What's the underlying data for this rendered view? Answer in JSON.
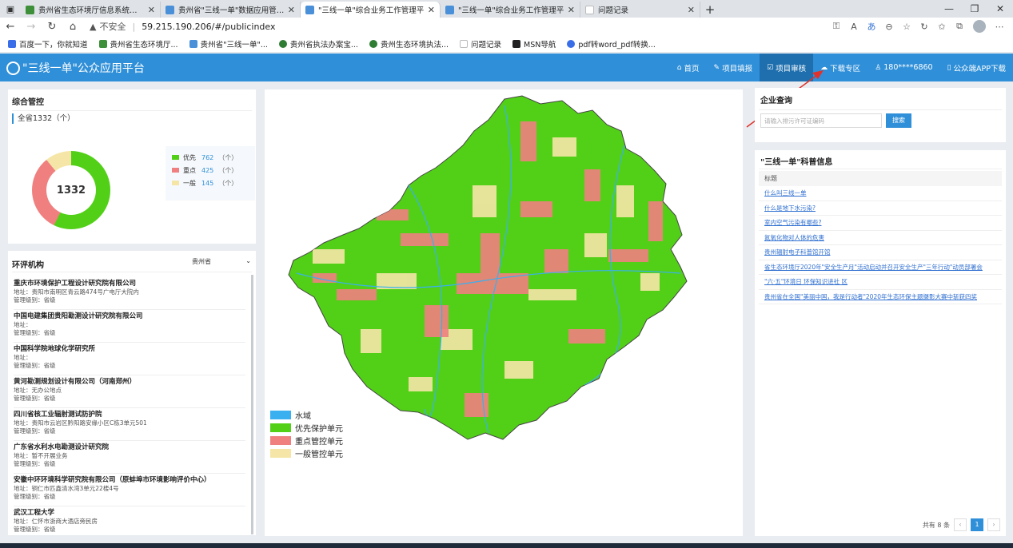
{
  "browser": {
    "tabs": [
      {
        "title": "贵州省生态环境厅信息系统统一",
        "color": "#3e8f3a"
      },
      {
        "title": "贵州省\"三线一单\"数据应用管理平",
        "color": "#4a90d9"
      },
      {
        "title": "\"三线一单\"综合业务工作管理平",
        "color": "#4a90d9"
      },
      {
        "title": "\"三线一单\"综合业务工作管理平",
        "color": "#4a90d9"
      },
      {
        "title": "问题记录",
        "color": "#bbbbbb"
      }
    ],
    "insecure_label": "不安全",
    "url": "59.215.190.206/#/publicindex",
    "bookmarks": [
      {
        "label": "百度一下，你就知道",
        "color": "#3a6ee8"
      },
      {
        "label": "贵州省生态环境厅...",
        "color": "#3e8f3a"
      },
      {
        "label": "贵州省\"三线一单\"...",
        "color": "#4a90d9"
      },
      {
        "label": "贵州省执法办案宝...",
        "color": "#2e7d32"
      },
      {
        "label": "贵州生态环境执法...",
        "color": "#2e7d32"
      },
      {
        "label": "问题记录",
        "color": "#bbbbbb"
      },
      {
        "label": "MSN导航",
        "color": "#222222"
      },
      {
        "label": "pdf转word_pdf转换...",
        "color": "#3a6ee8"
      }
    ]
  },
  "app": {
    "title": "\"三线一单\"公众应用平台",
    "nav": [
      {
        "label": "首页",
        "icon": "home-icon"
      },
      {
        "label": "项目填报",
        "icon": "edit-icon"
      },
      {
        "label": "项目审核",
        "icon": "check-icon",
        "active": true
      },
      {
        "label": "下载专区",
        "icon": "cloud-download-icon"
      },
      {
        "label": "180****6860",
        "icon": "user-icon"
      },
      {
        "label": "公众端APP下载",
        "icon": "phone-icon"
      }
    ]
  },
  "overview": {
    "title": "综合管控",
    "total_label": "全省1332（个）",
    "center_value": "1332",
    "legend": [
      {
        "label": "优先",
        "value": "762",
        "unit": "（个）",
        "color": "#52d017"
      },
      {
        "label": "重点",
        "value": "425",
        "unit": "（个）",
        "color": "#f08080"
      },
      {
        "label": "一般",
        "value": "145",
        "unit": "（个）",
        "color": "#f5e6a8"
      }
    ]
  },
  "orgs": {
    "title": "环评机构",
    "filter_value": "贵州省",
    "items": [
      {
        "name": "重庆市环境保护工程设计研究院有限公司",
        "address": "地址：贵阳市南明区青云路474号广电厅大院内",
        "level": "管理级别：省级"
      },
      {
        "name": "中国电建集团贵阳勘测设计研究院有限公司",
        "address": "地址：",
        "level": "管理级别：省级"
      },
      {
        "name": "中国科学院地球化学研究所",
        "address": "地址：",
        "level": "管理级别：省级"
      },
      {
        "name": "黄河勘测规划设计有限公司（河南郑州）",
        "address": "地址：无办公地点",
        "level": "管理级别：省级"
      },
      {
        "name": "四川省核工业辐射测试防护院",
        "address": "地址：贵阳市云岩区黔阳路安缘小区C栋3单元501",
        "level": "管理级别：省级"
      },
      {
        "name": "广东省水利水电勘测设计研究院",
        "address": "地址：暂不开展业务",
        "level": "管理级别：省级"
      },
      {
        "name": "安徽中环环境科学研究院有限公司（原蚌埠市环境影响评价中心）",
        "address": "地址：铜仁市匹鑫清水湾3单元22楼4号",
        "level": "管理级别：省级"
      },
      {
        "name": "武汉工程大学",
        "address": "地址：仁怀市浙商大酒店旁民房",
        "level": "管理级别：省级"
      }
    ]
  },
  "map": {
    "legend": [
      {
        "label": "水域",
        "color": "#3ab0f0"
      },
      {
        "label": "优先保护单元",
        "color": "#52d017"
      },
      {
        "label": "重点管控单元",
        "color": "#f08080"
      },
      {
        "label": "一般管控单元",
        "color": "#f5e6a8"
      }
    ]
  },
  "search": {
    "title": "企业查询",
    "placeholder": "请输入排污许可证编码",
    "button": "搜索"
  },
  "science": {
    "title": "\"三线一单\"科普信息",
    "column_header": "标题",
    "items": [
      "什么叫三线一单",
      "什么是地下水污染?",
      "室内空气污染有哪些?",
      "氮氧化物对人体的危害",
      "贵州辐射电子科普馆开馆",
      "省生态环境厅2020年\"安全生产月\"活动启动并召开安全生产\"三年行动\"动员部署会",
      "\"六·五\"环境日 环保知识进社 区",
      "贵州省在全国\"美丽中国，我是行动者\"2020年生态环保主题摄影大赛中斩获四奖"
    ],
    "total_text": "共有 8 条",
    "current_page": "1"
  }
}
